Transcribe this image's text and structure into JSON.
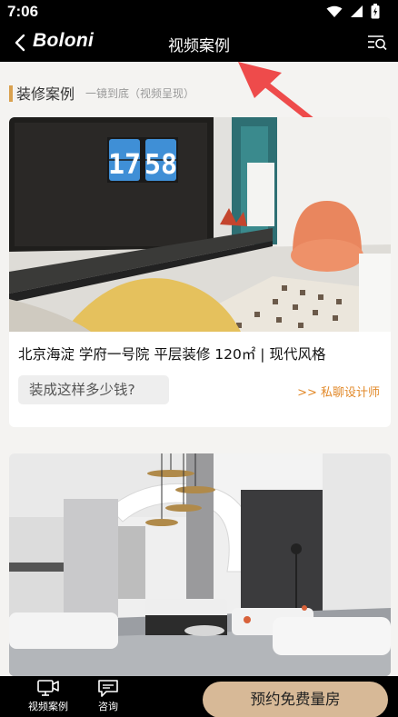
{
  "status_bar": {
    "time": "7:06"
  },
  "app_bar": {
    "logo": "Boloni",
    "title": "视频案例"
  },
  "section": {
    "heading": "装修案例",
    "subheading": "一镜到底（视频呈现）"
  },
  "cases": [
    {
      "title": "北京海淀 学府一号院 平层装修 120㎡ | 现代风格",
      "cost_button": "装成这样多少钱?",
      "consult_link": ">> 私聊设计师",
      "clock_reading": "17 58"
    }
  ],
  "bottom_nav": {
    "tabs": [
      {
        "label": "视频案例",
        "icon": "video-case-icon"
      },
      {
        "label": "咨询",
        "icon": "chat-icon"
      }
    ],
    "cta": "预约免费量房"
  },
  "colors": {
    "accent": "#d9a14f",
    "link": "#e28a2b",
    "cta_bg": "#d7b997"
  }
}
